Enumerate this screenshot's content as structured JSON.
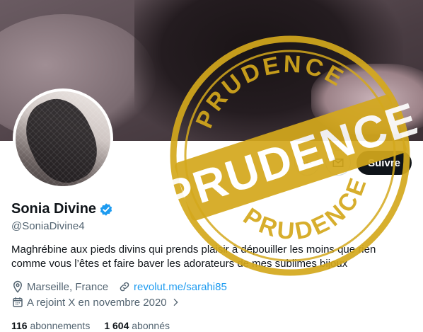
{
  "profile": {
    "name": "Sonia Divine",
    "handle": "@SoniaDivine4",
    "bio": "Maghrébine aux pieds divins qui prends plaisir à dépouiller les moins que rien comme vous l’êtes et faire baver les adorateurs de mes sublimes bijoux",
    "location": "Marseille, France",
    "website": "revolut.me/sarahi85",
    "joined": "A rejoint X en novembre 2020",
    "following_count": "116",
    "following_label": "abonnements",
    "followers_count": "1 604",
    "followers_label": "abonnés"
  },
  "actions": {
    "follow_label": "Suivre"
  },
  "stamp": {
    "word": "PRUDENCE",
    "color": "#d4a81c"
  },
  "colors": {
    "verified": "#1d9bf0",
    "link": "#1d9bf0"
  },
  "icons": [
    "more-icon",
    "message-icon",
    "verified-icon",
    "location-icon",
    "link-icon",
    "calendar-icon",
    "chevron-right-icon"
  ]
}
